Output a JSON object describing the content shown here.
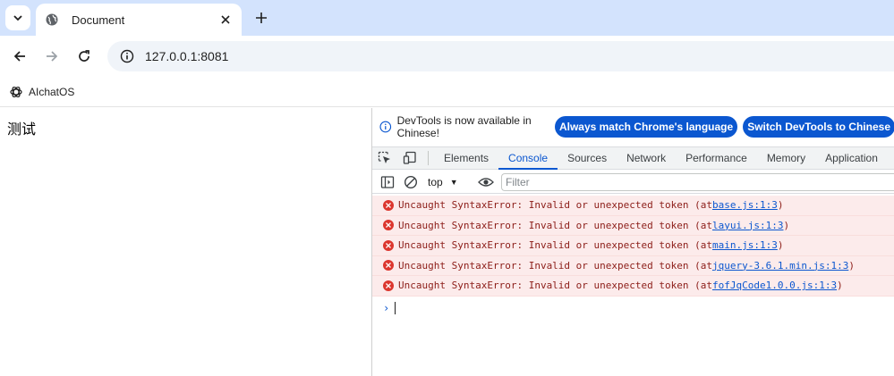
{
  "browser": {
    "tab": {
      "title": "Document"
    },
    "omnibox": {
      "url": "127.0.0.1:8081"
    },
    "bookmarks": [
      {
        "label": "AIchatOS"
      }
    ]
  },
  "page": {
    "text": "测试"
  },
  "devtools": {
    "infobar": {
      "message": "DevTools is now available in Chinese!",
      "button_match": "Always match Chrome's language",
      "button_switch": "Switch DevTools to Chinese"
    },
    "tabs": [
      "Elements",
      "Console",
      "Sources",
      "Network",
      "Performance",
      "Memory",
      "Application"
    ],
    "active_tab": "Console",
    "console_toolbar": {
      "context": "top",
      "filter_placeholder": "Filter"
    },
    "messages": [
      {
        "text": "Uncaught SyntaxError: Invalid or unexpected token (at ",
        "link": "base.js:1:3",
        "suffix": ")"
      },
      {
        "text": "Uncaught SyntaxError: Invalid or unexpected token (at ",
        "link": "layui.js:1:3",
        "suffix": ")"
      },
      {
        "text": "Uncaught SyntaxError: Invalid or unexpected token (at ",
        "link": "main.js:1:3",
        "suffix": ")"
      },
      {
        "text": "Uncaught SyntaxError: Invalid or unexpected token (at ",
        "link": "jquery-3.6.1.min.js:1:3",
        "suffix": ")"
      },
      {
        "text": "Uncaught SyntaxError: Invalid or unexpected token (at ",
        "link": "fofJqCode1.0.0.js:1:3",
        "suffix": ")"
      }
    ],
    "prompt_symbol": "›"
  },
  "colors": {
    "accent": "#0b57d0",
    "error_bg": "#fcebeb",
    "error_icon": "#dc362e",
    "tabstrip": "#d3e3fd"
  }
}
